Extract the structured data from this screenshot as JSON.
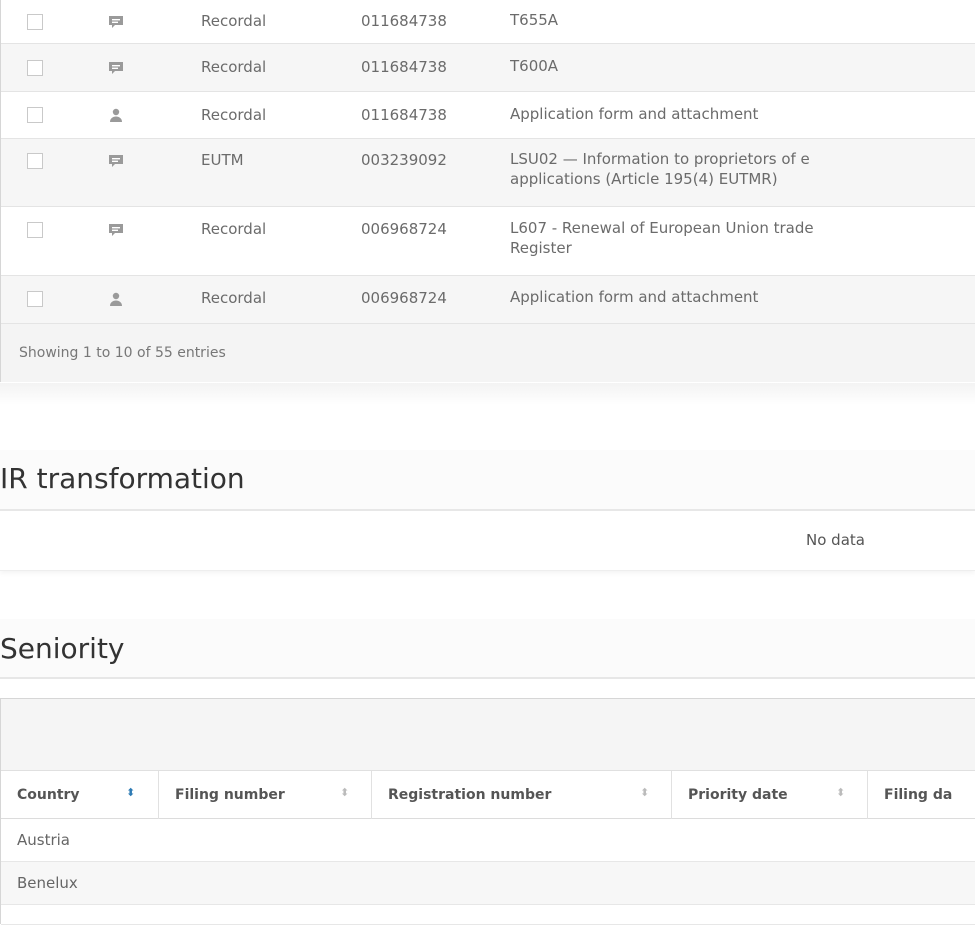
{
  "correspondence": {
    "rows": [
      {
        "icon": "message-icon",
        "kind": "Recordal",
        "number": "011684738",
        "doc": [
          "T655A"
        ]
      },
      {
        "icon": "message-icon",
        "kind": "Recordal",
        "number": "011684738",
        "doc": [
          "T600A"
        ]
      },
      {
        "icon": "user-icon",
        "kind": "Recordal",
        "number": "011684738",
        "doc": [
          "Application form and attachment"
        ]
      },
      {
        "icon": "message-icon",
        "kind": "EUTM",
        "number": "003239092",
        "doc": [
          "LSU02 — Information to proprietors of e",
          "applications (Article 195(4) EUTMR)"
        ]
      },
      {
        "icon": "message-icon",
        "kind": "Recordal",
        "number": "006968724",
        "doc": [
          "L607 - Renewal of European Union trade",
          "Register"
        ]
      },
      {
        "icon": "user-icon",
        "kind": "Recordal",
        "number": "006968724",
        "doc": [
          "Application form and attachment"
        ]
      }
    ],
    "footer": "Showing 1 to 10 of 55 entries"
  },
  "ir_transformation": {
    "title": "IR transformation",
    "empty": "No data"
  },
  "seniority": {
    "title": "Seniority",
    "columns": [
      "Country",
      "Filing number",
      "Registration number",
      "Priority date",
      "Filing da"
    ],
    "rows": [
      "Austria",
      "Benelux"
    ]
  },
  "colors": {
    "sort_active": "#2e7bb4",
    "row_alt": "#f6f6f6",
    "text": "#6b6b6b",
    "heading": "#333333"
  }
}
